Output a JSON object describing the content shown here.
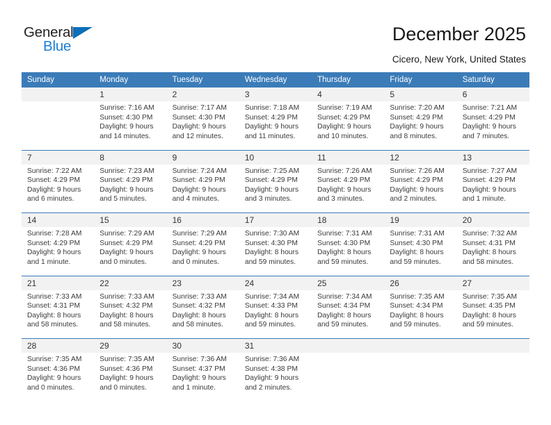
{
  "brand": {
    "word_one": "General",
    "word_two": "Blue",
    "triangle_icon": "triangle-icon",
    "color_dark": "#231f20",
    "color_blue": "#1b7fd4"
  },
  "header": {
    "title": "December 2025",
    "subtitle": "Cicero, New York, United States",
    "accent_color": "#3b7cb8"
  },
  "calendar": {
    "weekday_headers": [
      "Sunday",
      "Monday",
      "Tuesday",
      "Wednesday",
      "Thursday",
      "Friday",
      "Saturday"
    ],
    "weeks": [
      [
        {
          "day": "",
          "sunrise": "",
          "sunset": "",
          "daylight_1": "",
          "daylight_2": ""
        },
        {
          "day": "1",
          "sunrise": "Sunrise: 7:16 AM",
          "sunset": "Sunset: 4:30 PM",
          "daylight_1": "Daylight: 9 hours",
          "daylight_2": "and 14 minutes."
        },
        {
          "day": "2",
          "sunrise": "Sunrise: 7:17 AM",
          "sunset": "Sunset: 4:30 PM",
          "daylight_1": "Daylight: 9 hours",
          "daylight_2": "and 12 minutes."
        },
        {
          "day": "3",
          "sunrise": "Sunrise: 7:18 AM",
          "sunset": "Sunset: 4:29 PM",
          "daylight_1": "Daylight: 9 hours",
          "daylight_2": "and 11 minutes."
        },
        {
          "day": "4",
          "sunrise": "Sunrise: 7:19 AM",
          "sunset": "Sunset: 4:29 PM",
          "daylight_1": "Daylight: 9 hours",
          "daylight_2": "and 10 minutes."
        },
        {
          "day": "5",
          "sunrise": "Sunrise: 7:20 AM",
          "sunset": "Sunset: 4:29 PM",
          "daylight_1": "Daylight: 9 hours",
          "daylight_2": "and 8 minutes."
        },
        {
          "day": "6",
          "sunrise": "Sunrise: 7:21 AM",
          "sunset": "Sunset: 4:29 PM",
          "daylight_1": "Daylight: 9 hours",
          "daylight_2": "and 7 minutes."
        }
      ],
      [
        {
          "day": "7",
          "sunrise": "Sunrise: 7:22 AM",
          "sunset": "Sunset: 4:29 PM",
          "daylight_1": "Daylight: 9 hours",
          "daylight_2": "and 6 minutes."
        },
        {
          "day": "8",
          "sunrise": "Sunrise: 7:23 AM",
          "sunset": "Sunset: 4:29 PM",
          "daylight_1": "Daylight: 9 hours",
          "daylight_2": "and 5 minutes."
        },
        {
          "day": "9",
          "sunrise": "Sunrise: 7:24 AM",
          "sunset": "Sunset: 4:29 PM",
          "daylight_1": "Daylight: 9 hours",
          "daylight_2": "and 4 minutes."
        },
        {
          "day": "10",
          "sunrise": "Sunrise: 7:25 AM",
          "sunset": "Sunset: 4:29 PM",
          "daylight_1": "Daylight: 9 hours",
          "daylight_2": "and 3 minutes."
        },
        {
          "day": "11",
          "sunrise": "Sunrise: 7:26 AM",
          "sunset": "Sunset: 4:29 PM",
          "daylight_1": "Daylight: 9 hours",
          "daylight_2": "and 3 minutes."
        },
        {
          "day": "12",
          "sunrise": "Sunrise: 7:26 AM",
          "sunset": "Sunset: 4:29 PM",
          "daylight_1": "Daylight: 9 hours",
          "daylight_2": "and 2 minutes."
        },
        {
          "day": "13",
          "sunrise": "Sunrise: 7:27 AM",
          "sunset": "Sunset: 4:29 PM",
          "daylight_1": "Daylight: 9 hours",
          "daylight_2": "and 1 minute."
        }
      ],
      [
        {
          "day": "14",
          "sunrise": "Sunrise: 7:28 AM",
          "sunset": "Sunset: 4:29 PM",
          "daylight_1": "Daylight: 9 hours",
          "daylight_2": "and 1 minute."
        },
        {
          "day": "15",
          "sunrise": "Sunrise: 7:29 AM",
          "sunset": "Sunset: 4:29 PM",
          "daylight_1": "Daylight: 9 hours",
          "daylight_2": "and 0 minutes."
        },
        {
          "day": "16",
          "sunrise": "Sunrise: 7:29 AM",
          "sunset": "Sunset: 4:29 PM",
          "daylight_1": "Daylight: 9 hours",
          "daylight_2": "and 0 minutes."
        },
        {
          "day": "17",
          "sunrise": "Sunrise: 7:30 AM",
          "sunset": "Sunset: 4:30 PM",
          "daylight_1": "Daylight: 8 hours",
          "daylight_2": "and 59 minutes."
        },
        {
          "day": "18",
          "sunrise": "Sunrise: 7:31 AM",
          "sunset": "Sunset: 4:30 PM",
          "daylight_1": "Daylight: 8 hours",
          "daylight_2": "and 59 minutes."
        },
        {
          "day": "19",
          "sunrise": "Sunrise: 7:31 AM",
          "sunset": "Sunset: 4:30 PM",
          "daylight_1": "Daylight: 8 hours",
          "daylight_2": "and 59 minutes."
        },
        {
          "day": "20",
          "sunrise": "Sunrise: 7:32 AM",
          "sunset": "Sunset: 4:31 PM",
          "daylight_1": "Daylight: 8 hours",
          "daylight_2": "and 58 minutes."
        }
      ],
      [
        {
          "day": "21",
          "sunrise": "Sunrise: 7:33 AM",
          "sunset": "Sunset: 4:31 PM",
          "daylight_1": "Daylight: 8 hours",
          "daylight_2": "and 58 minutes."
        },
        {
          "day": "22",
          "sunrise": "Sunrise: 7:33 AM",
          "sunset": "Sunset: 4:32 PM",
          "daylight_1": "Daylight: 8 hours",
          "daylight_2": "and 58 minutes."
        },
        {
          "day": "23",
          "sunrise": "Sunrise: 7:33 AM",
          "sunset": "Sunset: 4:32 PM",
          "daylight_1": "Daylight: 8 hours",
          "daylight_2": "and 58 minutes."
        },
        {
          "day": "24",
          "sunrise": "Sunrise: 7:34 AM",
          "sunset": "Sunset: 4:33 PM",
          "daylight_1": "Daylight: 8 hours",
          "daylight_2": "and 59 minutes."
        },
        {
          "day": "25",
          "sunrise": "Sunrise: 7:34 AM",
          "sunset": "Sunset: 4:34 PM",
          "daylight_1": "Daylight: 8 hours",
          "daylight_2": "and 59 minutes."
        },
        {
          "day": "26",
          "sunrise": "Sunrise: 7:35 AM",
          "sunset": "Sunset: 4:34 PM",
          "daylight_1": "Daylight: 8 hours",
          "daylight_2": "and 59 minutes."
        },
        {
          "day": "27",
          "sunrise": "Sunrise: 7:35 AM",
          "sunset": "Sunset: 4:35 PM",
          "daylight_1": "Daylight: 8 hours",
          "daylight_2": "and 59 minutes."
        }
      ],
      [
        {
          "day": "28",
          "sunrise": "Sunrise: 7:35 AM",
          "sunset": "Sunset: 4:36 PM",
          "daylight_1": "Daylight: 9 hours",
          "daylight_2": "and 0 minutes."
        },
        {
          "day": "29",
          "sunrise": "Sunrise: 7:35 AM",
          "sunset": "Sunset: 4:36 PM",
          "daylight_1": "Daylight: 9 hours",
          "daylight_2": "and 0 minutes."
        },
        {
          "day": "30",
          "sunrise": "Sunrise: 7:36 AM",
          "sunset": "Sunset: 4:37 PM",
          "daylight_1": "Daylight: 9 hours",
          "daylight_2": "and 1 minute."
        },
        {
          "day": "31",
          "sunrise": "Sunrise: 7:36 AM",
          "sunset": "Sunset: 4:38 PM",
          "daylight_1": "Daylight: 9 hours",
          "daylight_2": "and 2 minutes."
        },
        {
          "day": "",
          "sunrise": "",
          "sunset": "",
          "daylight_1": "",
          "daylight_2": ""
        },
        {
          "day": "",
          "sunrise": "",
          "sunset": "",
          "daylight_1": "",
          "daylight_2": ""
        },
        {
          "day": "",
          "sunrise": "",
          "sunset": "",
          "daylight_1": "",
          "daylight_2": ""
        }
      ]
    ]
  }
}
